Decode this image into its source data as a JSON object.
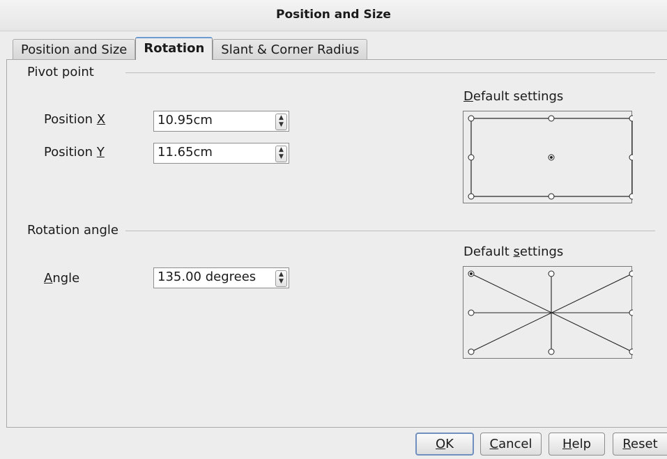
{
  "dialog": {
    "title": "Position and Size"
  },
  "tabs": [
    {
      "label": "Position and Size",
      "active": false
    },
    {
      "label": "Rotation",
      "active": true
    },
    {
      "label": "Slant & Corner Radius",
      "active": false
    }
  ],
  "pivot": {
    "section_label": "Pivot point",
    "pos_x": {
      "label_pre": "Position ",
      "label_key": "X",
      "label_post": "",
      "value": "10.95cm"
    },
    "pos_y": {
      "label_pre": "Position ",
      "label_key": "Y",
      "label_post": "",
      "value": "11.65cm"
    },
    "default_settings": {
      "pre": "",
      "key": "D",
      "post": "efault settings"
    },
    "selected_point": "center"
  },
  "rotation": {
    "section_label": "Rotation angle",
    "angle": {
      "label_pre": "",
      "label_key": "A",
      "label_post": "ngle",
      "value": "135.00 degrees"
    },
    "default_settings": {
      "pre": "Default ",
      "key": "s",
      "post": "ettings"
    },
    "selected_point": "top-left"
  },
  "buttons": {
    "ok": {
      "pre": "",
      "key": "O",
      "post": "K"
    },
    "cancel": {
      "pre": "",
      "key": "C",
      "post": "ancel"
    },
    "help": {
      "pre": "",
      "key": "H",
      "post": "elp"
    },
    "reset": {
      "pre": "",
      "key": "R",
      "post": "eset"
    }
  }
}
